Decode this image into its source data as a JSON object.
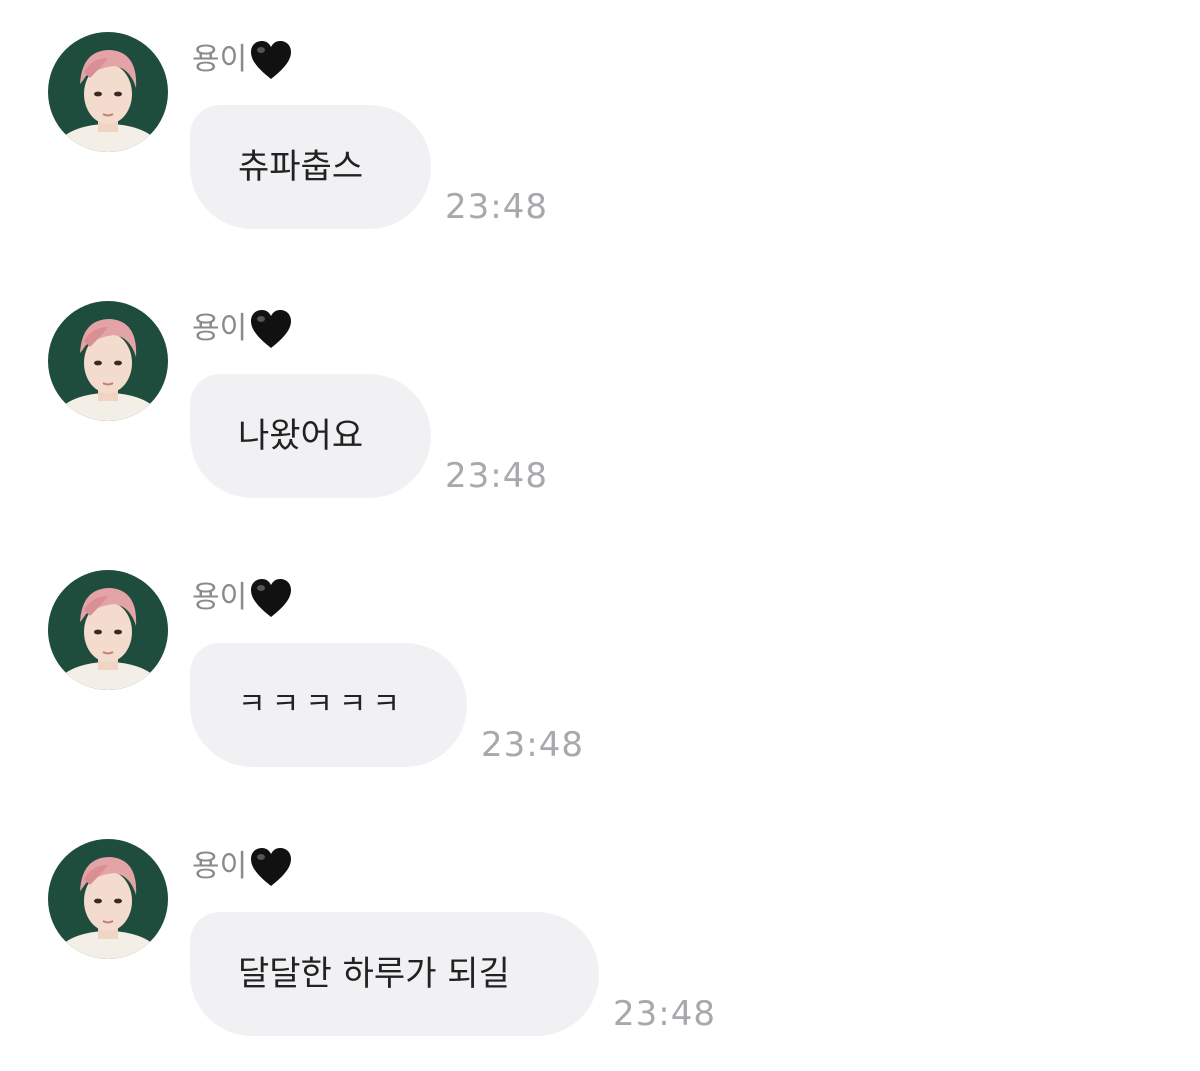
{
  "chat": {
    "messages": [
      {
        "sender": "용이",
        "sender_badge_icon": "black-heart-icon",
        "text": "츄파춥스",
        "time": "23:48"
      },
      {
        "sender": "용이",
        "sender_badge_icon": "black-heart-icon",
        "text": "나왔어요",
        "time": "23:48"
      },
      {
        "sender": "용이",
        "sender_badge_icon": "black-heart-icon",
        "text": "ㅋㅋㅋㅋㅋ",
        "time": "23:48"
      },
      {
        "sender": "용이",
        "sender_badge_icon": "black-heart-icon",
        "text": "달달한 하루가 되길",
        "time": "23:48"
      }
    ]
  },
  "colors": {
    "background": "#ffffff",
    "bubble": "#f1f1f4",
    "message_text": "#222222",
    "sender_name": "#8a8a8e",
    "timestamp": "#a8a8ad",
    "avatar_background": "#1f4d3d",
    "avatar_hair": "#e4a3a6"
  }
}
